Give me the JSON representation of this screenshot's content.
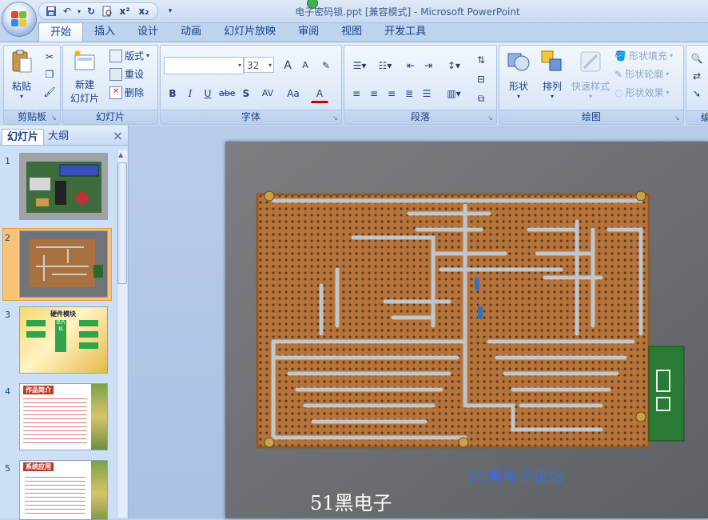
{
  "window": {
    "title": "电子密码锁.ppt [兼容模式] - Microsoft PowerPoint"
  },
  "qat": {
    "items": [
      "save-icon",
      "undo-icon",
      "redo-icon",
      "preview-icon",
      "superscript-icon",
      "subscript-icon",
      "more-icon"
    ],
    "sup_label": "x²",
    "sub_label": "x₂"
  },
  "tabs": [
    "开始",
    "插入",
    "设计",
    "动画",
    "幻灯片放映",
    "审阅",
    "视图",
    "开发工具"
  ],
  "ribbon": {
    "clipboard": {
      "label": "剪贴板",
      "paste": "粘贴"
    },
    "slides": {
      "label": "幻灯片",
      "new_slide_1": "新建",
      "new_slide_2": "幻灯片",
      "layout": "版式",
      "reset": "重设",
      "delete": "删除"
    },
    "font": {
      "label": "字体",
      "font_name": "",
      "font_size": "32",
      "bold": "B",
      "italic": "I",
      "underline": "U",
      "strike": "abe",
      "shadow": "S",
      "spacing": "AV",
      "case": "Aa",
      "color": "A",
      "grow": "A",
      "shrink": "A"
    },
    "paragraph": {
      "label": "段落"
    },
    "drawing": {
      "label": "绘图",
      "shapes": "形状",
      "arrange": "排列",
      "quick_styles": "快速样式",
      "fill": "形状填充",
      "outline": "形状轮廓",
      "effects": "形状效果"
    },
    "editing": {
      "label": "编"
    }
  },
  "pane": {
    "tab_slides": "幻灯片",
    "tab_outline": "大纲",
    "close": "×"
  },
  "thumbnails": [
    {
      "num": "1"
    },
    {
      "num": "2",
      "selected": true
    },
    {
      "num": "3",
      "title": "硬件模块",
      "chip": "单片机"
    },
    {
      "num": "4",
      "title": "作品简介"
    },
    {
      "num": "5",
      "title": "系统应用"
    }
  ],
  "slide": {
    "watermark_left": "51黑电子",
    "watermark_right": "51黑电子论坛"
  },
  "colors": {
    "ribbon_bg": "#d5e4f6",
    "accent": "#15428b",
    "selected_thumb": "#f9c27a",
    "pcb": "#b7743a"
  }
}
